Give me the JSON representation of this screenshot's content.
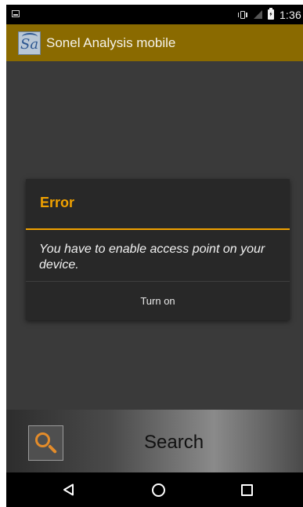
{
  "status_bar": {
    "time": "1:36",
    "icons": [
      "notification-icon",
      "vibrate-icon",
      "no-signal-icon",
      "battery-charging-icon"
    ]
  },
  "app_bar": {
    "logo_text": "Sa",
    "title": "Sonel Analysis mobile",
    "color": "#8a6a00"
  },
  "dialog": {
    "title": "Error",
    "message": "You have to enable access point on your device.",
    "button_label": "Turn on",
    "accent_color": "#f0a100"
  },
  "search_bar": {
    "icon": "search-icon",
    "label": "Search"
  },
  "nav_bar": {
    "buttons": [
      "back-icon",
      "home-icon",
      "recents-icon"
    ]
  }
}
